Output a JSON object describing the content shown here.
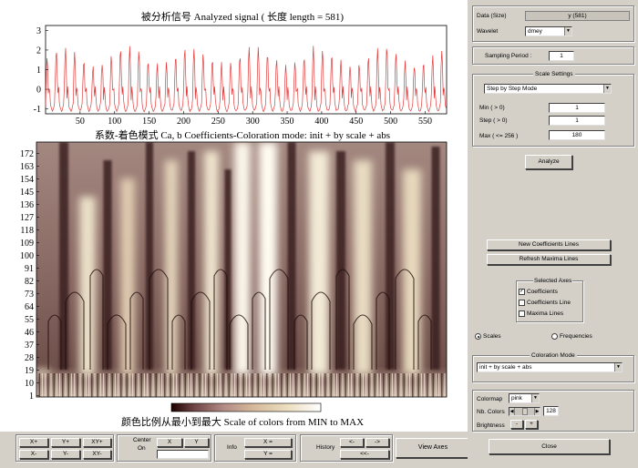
{
  "signal_plot": {
    "title": "被分析信号 Analyzed signal ( 长度 length = 581)",
    "x_ticks": [
      "50",
      "100",
      "150",
      "200",
      "250",
      "300",
      "350",
      "400",
      "450",
      "500",
      "550"
    ],
    "y_ticks": [
      "3",
      "2",
      "1",
      "0",
      "-1"
    ],
    "line_color": "#e23b3b"
  },
  "coef_plot": {
    "title": "系数-着色模式  Ca, b Coefficients-Coloration mode: init + by scale + abs",
    "y_ticks": [
      "172",
      "163",
      "154",
      "145",
      "136",
      "127",
      "118",
      "109",
      "100",
      "91",
      "82",
      "73",
      "64",
      "55",
      "46",
      "37",
      "28",
      "19",
      "10",
      "1"
    ]
  },
  "colorbar": {
    "caption": "颜色比例从最小到最大 Scale of colors from MIN to MAX"
  },
  "bottom_bar": {
    "zoom": {
      "x_plus": "X+",
      "y_plus": "Y+",
      "xy_plus": "XY+",
      "x_minus": "X-",
      "y_minus": "Y-",
      "xy_minus": "XY-"
    },
    "center": {
      "label_line1": "Center",
      "label_line2": "On",
      "x": "X",
      "y": "Y"
    },
    "info": {
      "label": "Info",
      "x": "X =",
      "y": "Y ="
    },
    "history": {
      "label": "History",
      "back": "<-",
      "forward": "->",
      "first": "<<-"
    },
    "view_axes": "View Axes"
  },
  "right_panel": {
    "data_label": "Data (Size)",
    "data_value": "y  (581)",
    "wavelet_label": "Wavelet",
    "wavelet_value": "dmey",
    "sampling_label": "Sampling Period :",
    "sampling_value": "1",
    "scale_settings": {
      "title": "Scale Settings",
      "mode": "Step by Step Mode",
      "min_label": "Min  ( > 0)",
      "min_value": "1",
      "step_label": "Step ( > 0)",
      "step_value": "1",
      "max_label": "Max  ( <= 256 )",
      "max_value": "180"
    },
    "analyze": "Analyze",
    "new_coef_lines": "New Coefficients Lines",
    "refresh_maxima": "Refresh Maxima Lines",
    "selected_axes": {
      "title": "Selected Axes",
      "coefficients": "Coefficients",
      "coefficients_line": "Coefficients Line",
      "maxima_lines": "Maxima Lines"
    },
    "scales": "Scales",
    "frequencies": "Frequencies",
    "coloration": {
      "title": "Coloration Mode",
      "value": "init + by scale + abs"
    },
    "colormap_label": "Colormap",
    "colormap_value": "pink",
    "ncolors_label": "Nb. Colors",
    "ncolors_value": "128",
    "brightness_label": "Brightness",
    "brightness_minus": "-",
    "brightness_plus": "+",
    "close": "Close"
  }
}
